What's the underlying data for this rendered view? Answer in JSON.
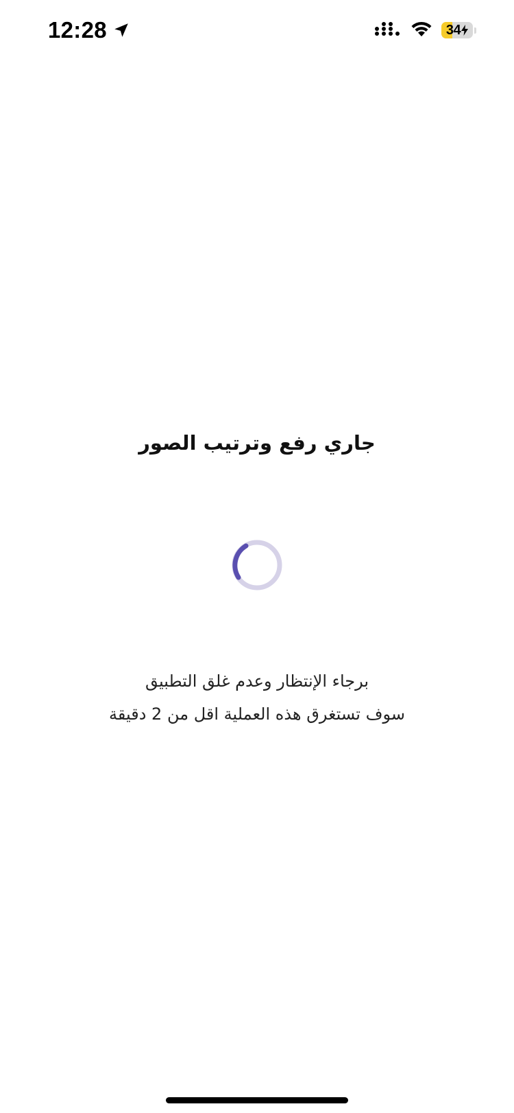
{
  "status_bar": {
    "time": "12:28",
    "battery_level": "34",
    "battery_fraction": 0.34,
    "battery_color": "#f6cb2a",
    "icons": [
      "location-arrow-icon",
      "cellular-signal-icon",
      "wifi-icon",
      "battery-charging-icon"
    ]
  },
  "main": {
    "title": "جاري رفع وترتيب الصور",
    "spinner": {
      "track_color": "#d6d2e8",
      "arc_color": "#5a4fb0"
    },
    "message_lines": [
      "برجاء الإنتظار وعدم غلق التطبيق",
      "سوف تستغرق هذه العملية اقل من 2 دقيقة"
    ]
  }
}
